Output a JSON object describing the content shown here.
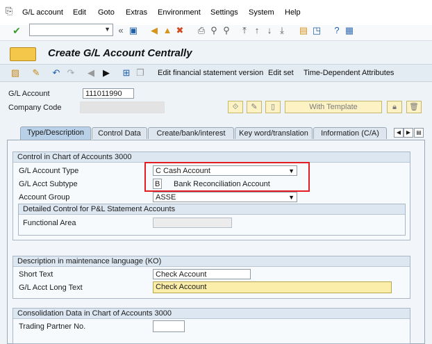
{
  "menu": {
    "items": [
      "G/L account",
      "Edit",
      "Goto",
      "Extras",
      "Environment",
      "Settings",
      "System",
      "Help"
    ]
  },
  "title": "Create G/L Account Centrally",
  "app_toolbar": {
    "edit_fs_version": "Edit financial statement version",
    "edit_set": "Edit set",
    "time_dependent": "Time-Dependent Attributes"
  },
  "header": {
    "gl_account_label": "G/L Account",
    "gl_account_value": "111011990",
    "company_code_label": "Company Code",
    "company_code_value": "",
    "with_template_label": "With Template"
  },
  "tabs": [
    {
      "label": "Type/Description",
      "active": true
    },
    {
      "label": "Control Data",
      "active": false
    },
    {
      "label": "Create/bank/interest",
      "active": false
    },
    {
      "label": "Key word/translation",
      "active": false
    },
    {
      "label": "Information (C/A)",
      "active": false
    }
  ],
  "control_group": {
    "title": "Control in Chart of Accounts 3000",
    "account_type_label": "G/L Account Type",
    "account_type_value": "C Cash Account",
    "subtype_label": "G/L Acct Subtype",
    "subtype_code": "B",
    "subtype_text": "Bank Reconciliation Account",
    "account_group_label": "Account Group",
    "account_group_value": "ASSE",
    "pl_group_title": "Detailed Control for P&L Statement Accounts",
    "functional_area_label": "Functional Area",
    "functional_area_value": ""
  },
  "description_group": {
    "title": "Description in maintenance language (KO)",
    "short_text_label": "Short Text",
    "short_text_value": "Check Account",
    "long_text_label": "G/L Acct Long Text",
    "long_text_value": "Check Account"
  },
  "consolidation_group": {
    "title": "Consolidation Data in Chart of Accounts 3000",
    "trading_partner_label": "Trading Partner No.",
    "trading_partner_value": ""
  },
  "colors": {
    "highlight_box": "#e31b23",
    "required_field": "#fbeeaa",
    "active_tab": "#b8d0e8"
  }
}
